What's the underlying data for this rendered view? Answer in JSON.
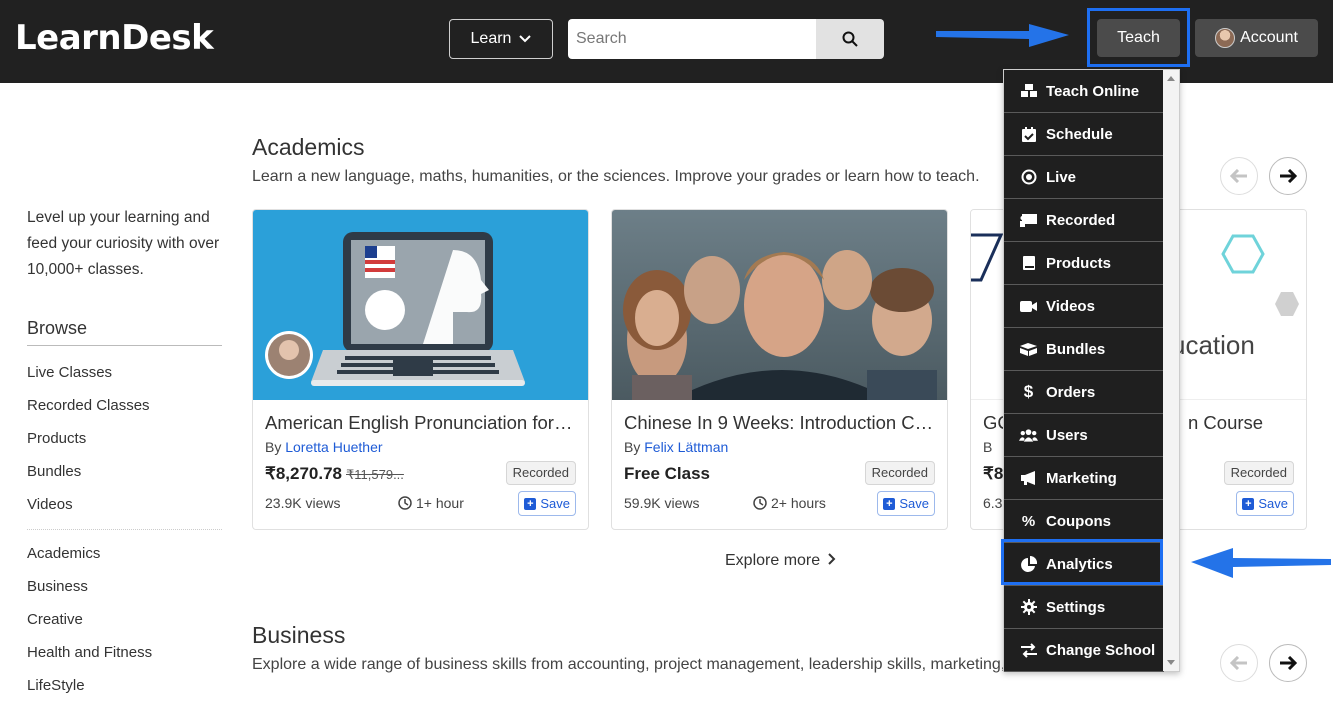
{
  "header": {
    "logo": "LearnDesk",
    "learn_label": "Learn",
    "search_placeholder": "Search",
    "teach_label": "Teach",
    "account_label": "Account"
  },
  "sidebar": {
    "tagline": "Level up your learning and feed your curiosity with over 10,000+ classes.",
    "browse_title": "Browse",
    "browse_items": [
      "Live Classes",
      "Recorded Classes",
      "Products",
      "Bundles",
      "Videos"
    ],
    "category_items": [
      "Academics",
      "Business",
      "Creative",
      "Health and Fitness",
      "LifeStyle"
    ]
  },
  "sections": {
    "academics": {
      "title": "Academics",
      "description": "Learn a new language, maths, humanities, or the sciences. Improve your grades or learn how to teach."
    },
    "business": {
      "title": "Business",
      "description": "Explore a wide range of business skills from accounting, project management, leadership skills, marketing,"
    }
  },
  "cards": [
    {
      "title": "American English Pronunciation for …",
      "by": "By",
      "author": "Loretta Huether",
      "price": "₹8,270.78",
      "old_price": "₹11,579...",
      "badge": "Recorded",
      "views": "23.9K views",
      "duration": "1+ hour",
      "save": "Save"
    },
    {
      "title": "Chinese In 9 Weeks: Introduction Co…",
      "by": "By",
      "author": "Felix Lättman",
      "price": "Free Class",
      "badge": "Recorded",
      "views": "59.9K views",
      "duration": "2+ hours",
      "save": "Save"
    },
    {
      "title": "GC",
      "title_tail": "n Course",
      "by": "B",
      "price": "₹8",
      "views": "6.3",
      "badge": "Recorded",
      "save": "Save",
      "thumb_text": "ucation"
    }
  ],
  "explore_label": "Explore more",
  "teach_menu": [
    {
      "label": "Teach Online",
      "icon": "cubes-icon"
    },
    {
      "label": "Schedule",
      "icon": "calendar-check-icon"
    },
    {
      "label": "Live",
      "icon": "dot-circle-icon"
    },
    {
      "label": "Recorded",
      "icon": "chalkboard-icon"
    },
    {
      "label": "Products",
      "icon": "book-icon"
    },
    {
      "label": "Videos",
      "icon": "video-icon"
    },
    {
      "label": "Bundles",
      "icon": "boxes-icon"
    },
    {
      "label": "Orders",
      "icon": "dollar-icon"
    },
    {
      "label": "Users",
      "icon": "users-icon"
    },
    {
      "label": "Marketing",
      "icon": "bullhorn-icon"
    },
    {
      "label": "Coupons",
      "icon": "percent-icon"
    },
    {
      "label": "Analytics",
      "icon": "chart-pie-icon"
    },
    {
      "label": "Settings",
      "icon": "gear-icon"
    },
    {
      "label": "Change School",
      "icon": "exchange-icon"
    }
  ],
  "colors": {
    "header_bg": "#212121",
    "highlight": "#1e6ff2",
    "link": "#1e5bd6",
    "menu_bg": "#1f1f1f"
  }
}
